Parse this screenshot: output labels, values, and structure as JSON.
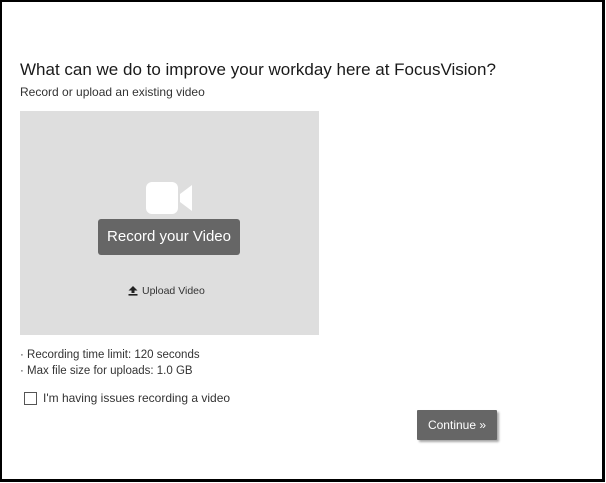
{
  "survey": {
    "question": "What can we do to improve your workday here at FocusVision?",
    "subtext": "Record or upload an existing video"
  },
  "recorder": {
    "record_label": "Record your Video",
    "upload_label": "Upload Video",
    "camera_icon": "video-camera-icon",
    "upload_icon": "upload-icon"
  },
  "info": {
    "time_limit": "· Recording time limit: 120 seconds",
    "max_size": "· Max file size for uploads: 1.0 GB"
  },
  "issue": {
    "label": "I'm having issues recording a video",
    "checked": false
  },
  "actions": {
    "continue_label": "Continue »"
  },
  "colors": {
    "recorder_bg": "#dedede",
    "button_bg": "#666666",
    "button_text": "#ffffff"
  }
}
